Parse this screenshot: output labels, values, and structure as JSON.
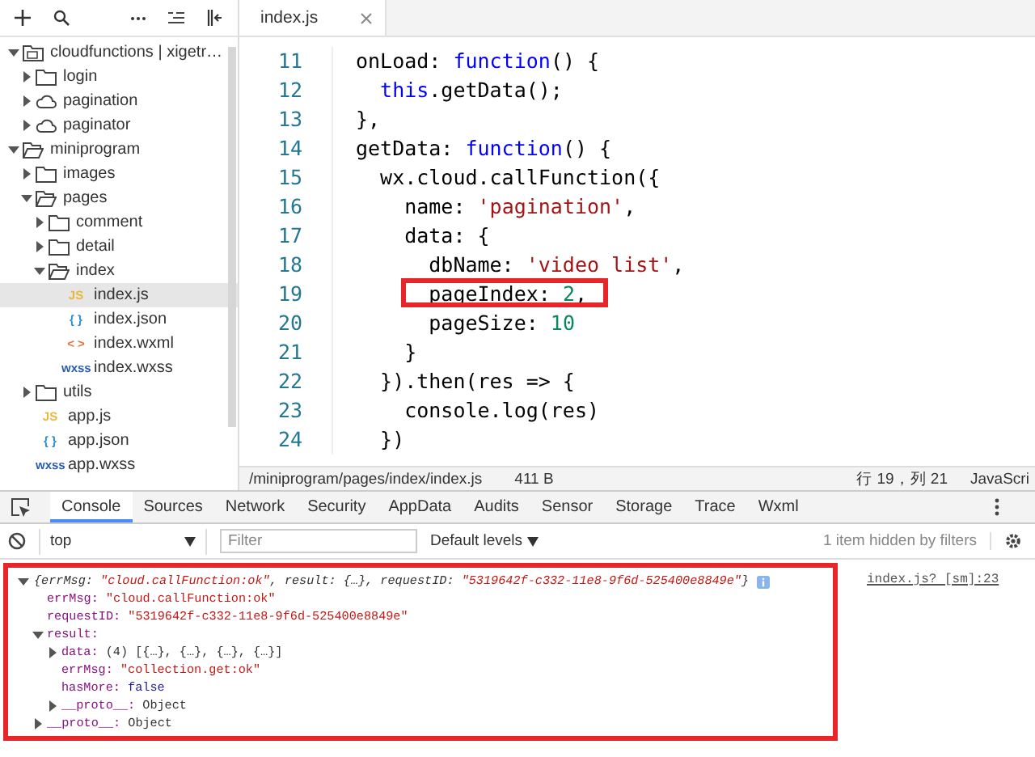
{
  "sidebar": {
    "tree": [
      {
        "label": "cloudfunctions | xigetr…",
        "kind": "project",
        "expanded": true,
        "selected": false,
        "children": [
          {
            "label": "login",
            "kind": "folder",
            "expanded": false,
            "selected": false
          },
          {
            "label": "pagination",
            "kind": "cloud",
            "expanded": false,
            "selected": false
          },
          {
            "label": "paginator",
            "kind": "cloud",
            "expanded": false,
            "selected": false
          }
        ]
      },
      {
        "label": "miniprogram",
        "kind": "folder",
        "expanded": true,
        "selected": false,
        "children": [
          {
            "label": "images",
            "kind": "folder",
            "expanded": false,
            "selected": false
          },
          {
            "label": "pages",
            "kind": "folder",
            "expanded": true,
            "selected": false,
            "children": [
              {
                "label": "comment",
                "kind": "folder",
                "expanded": false,
                "selected": false
              },
              {
                "label": "detail",
                "kind": "folder",
                "expanded": false,
                "selected": false
              },
              {
                "label": "index",
                "kind": "folder",
                "expanded": true,
                "selected": false,
                "children": [
                  {
                    "label": "index.js",
                    "kind": "file",
                    "badge": "JS",
                    "color": "#e8b83a",
                    "selected": true
                  },
                  {
                    "label": "index.json",
                    "kind": "file",
                    "badge": "{ }",
                    "color": "#2f8fd0",
                    "selected": false
                  },
                  {
                    "label": "index.wxml",
                    "kind": "file",
                    "badge": "< >",
                    "color": "#e07a3c",
                    "selected": false
                  },
                  {
                    "label": "index.wxss",
                    "kind": "file",
                    "badge": "wxss",
                    "color": "#2a5db0",
                    "selected": false
                  }
                ]
              }
            ]
          },
          {
            "label": "utils",
            "kind": "folder",
            "expanded": false,
            "selected": false
          },
          {
            "label": "app.js",
            "kind": "file",
            "badge": "JS",
            "color": "#e8b83a",
            "selected": false
          },
          {
            "label": "app.json",
            "kind": "file",
            "badge": "{ }",
            "color": "#2f8fd0",
            "selected": false
          },
          {
            "label": "app.wxss",
            "kind": "file",
            "badge": "wxss",
            "color": "#2a5db0",
            "selected": false
          }
        ]
      }
    ]
  },
  "editor": {
    "tabs": [
      {
        "label": "index.js",
        "selected": true
      }
    ],
    "lines": [
      {
        "number": "11",
        "highlighted": false,
        "tokens": [
          {
            "text": "onLoad: ",
            "kind": "plain"
          },
          {
            "text": "function",
            "kind": "keyword"
          },
          {
            "text": "() {",
            "kind": "plain"
          }
        ]
      },
      {
        "number": "12",
        "highlighted": false,
        "tokens": [
          {
            "text": "  this",
            "kind": "keyword"
          },
          {
            "text": ".getData();",
            "kind": "plain"
          }
        ]
      },
      {
        "number": "13",
        "highlighted": false,
        "tokens": [
          {
            "text": "},",
            "kind": "plain"
          }
        ]
      },
      {
        "number": "14",
        "highlighted": false,
        "tokens": [
          {
            "text": "getData: ",
            "kind": "plain"
          },
          {
            "text": "function",
            "kind": "keyword"
          },
          {
            "text": "() {",
            "kind": "plain"
          }
        ]
      },
      {
        "number": "15",
        "highlighted": false,
        "tokens": [
          {
            "text": "  wx.cloud.callFunction({",
            "kind": "plain"
          }
        ]
      },
      {
        "number": "16",
        "highlighted": false,
        "tokens": [
          {
            "text": "    name: ",
            "kind": "plain"
          },
          {
            "text": "'pagination'",
            "kind": "string"
          },
          {
            "text": ",",
            "kind": "plain"
          }
        ]
      },
      {
        "number": "17",
        "highlighted": false,
        "tokens": [
          {
            "text": "    data: {",
            "kind": "plain"
          }
        ]
      },
      {
        "number": "18",
        "highlighted": false,
        "tokens": [
          {
            "text": "      dbName: ",
            "kind": "plain"
          },
          {
            "text": "'video list'",
            "kind": "string"
          },
          {
            "text": ",",
            "kind": "plain"
          }
        ]
      },
      {
        "number": "19",
        "highlighted": true,
        "tokens": [
          {
            "text": "      pageIndex: ",
            "kind": "plain"
          },
          {
            "text": "2",
            "kind": "number"
          },
          {
            "text": ",",
            "kind": "plain"
          }
        ]
      },
      {
        "number": "20",
        "highlighted": false,
        "tokens": [
          {
            "text": "      pageSize: ",
            "kind": "plain"
          },
          {
            "text": "10",
            "kind": "number"
          }
        ]
      },
      {
        "number": "21",
        "highlighted": false,
        "tokens": [
          {
            "text": "    }",
            "kind": "plain"
          }
        ]
      },
      {
        "number": "22",
        "highlighted": false,
        "tokens": [
          {
            "text": "  }).then(res => {",
            "kind": "plain"
          }
        ]
      },
      {
        "number": "23",
        "highlighted": false,
        "tokens": [
          {
            "text": "    console.log(res)",
            "kind": "plain"
          }
        ]
      },
      {
        "number": "24",
        "highlighted": false,
        "tokens": [
          {
            "text": "  })",
            "kind": "plain"
          }
        ]
      }
    ],
    "status_bar": {
      "path": "/miniprogram/pages/index/index.js",
      "size": "411 B",
      "position": "行 19，列 21",
      "language": "JavaScri"
    }
  },
  "devtools": {
    "tabs": [
      {
        "label": "Console",
        "selected": true
      },
      {
        "label": "Sources",
        "selected": false
      },
      {
        "label": "Network",
        "selected": false
      },
      {
        "label": "Security",
        "selected": false
      },
      {
        "label": "AppData",
        "selected": false
      },
      {
        "label": "Audits",
        "selected": false
      },
      {
        "label": "Sensor",
        "selected": false
      },
      {
        "label": "Storage",
        "selected": false
      },
      {
        "label": "Trace",
        "selected": false
      },
      {
        "label": "Wxml",
        "selected": false
      }
    ],
    "context": "top",
    "filter": {
      "placeholder": "Filter"
    },
    "levels": "Default levels",
    "hidden_note": "1 item hidden by filters",
    "console": {
      "highlighted": true,
      "source": "index.js? [sm]:23",
      "expanded": true,
      "summary": [
        {
          "text": "{errMsg: ",
          "kind": "key"
        },
        {
          "text": "\"cloud.callFunction:ok\"",
          "kind": "string"
        },
        {
          "text": ", result: {…}, requestID: ",
          "kind": "key"
        },
        {
          "text": "\"5319642f-c332-11e8-9f6d-525400e8849e\"",
          "kind": "string"
        },
        {
          "text": "}",
          "kind": "key"
        }
      ],
      "children": [
        {
          "key": "errMsg:",
          "value": "\"cloud.callFunction:ok\"",
          "kind": "string"
        },
        {
          "key": "requestID:",
          "value": "\"5319642f-c332-11e8-9f6d-525400e8849e\"",
          "kind": "string"
        },
        {
          "key": "result:",
          "kind": "object",
          "expanded": true,
          "children": [
            {
              "key": "data:",
              "value": "(4) [{…}, {…}, {…}, {…}]",
              "kind": "preview",
              "expanded": false
            },
            {
              "key": "errMsg:",
              "value": "\"collection.get:ok\"",
              "kind": "string"
            },
            {
              "key": "hasMore:",
              "value": "false",
              "kind": "boolean"
            },
            {
              "key": "__proto__:",
              "value": "Object",
              "kind": "object",
              "expanded": false
            }
          ]
        },
        {
          "key": "__proto__:",
          "value": "Object",
          "kind": "object",
          "expanded": false
        }
      ]
    }
  }
}
